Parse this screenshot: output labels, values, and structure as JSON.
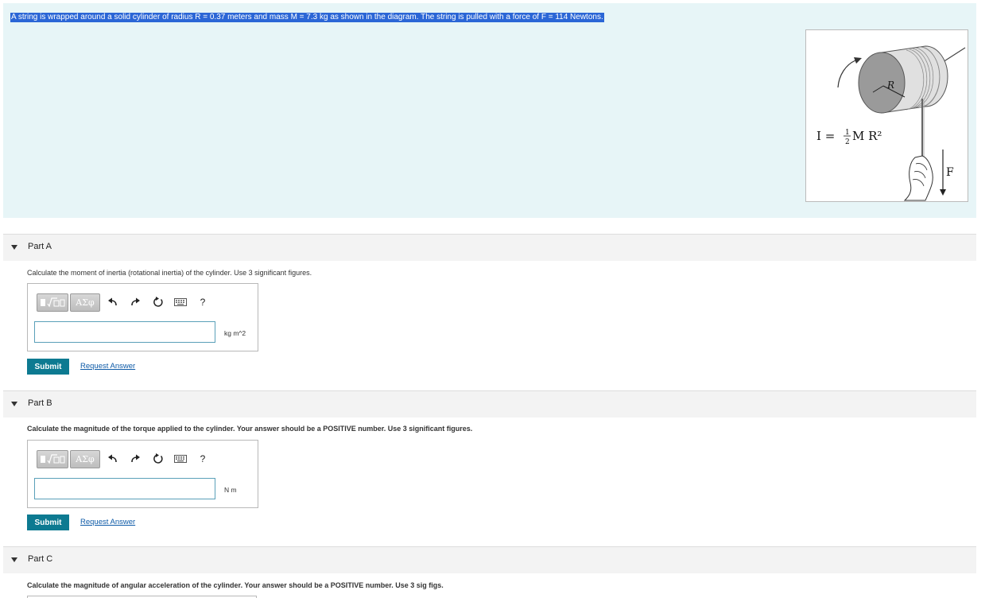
{
  "problem": {
    "statement": "A string is wrapped around a solid cylinder of radius R = 0.37 meters and mass M = 7.3 kg as shown in the diagram.  The string is pulled with a force of F = 114 Newtons.",
    "figure": {
      "radius_label": "R",
      "inertia_prefix": "I = ",
      "fraction_num": "1",
      "fraction_den": "2",
      "inertia_suffix": "M R²",
      "force_label": "F"
    }
  },
  "toolbar": {
    "symbols_label": "ΑΣφ",
    "help_label": "?"
  },
  "parts": [
    {
      "title": "Part A",
      "instruction": "Calculate the moment of inertia (rotational inertia) of the cylinder.  Use 3 significant figures.",
      "answer_value": "",
      "unit": "kg m^2",
      "submit_label": "Submit",
      "request_label": "Request Answer"
    },
    {
      "title": "Part B",
      "instruction": "Calculate the magnitude of the torque applied to the cylinder.  Your answer should be a POSITIVE number.  Use 3 significant figures.",
      "answer_value": "",
      "unit": "N m",
      "submit_label": "Submit",
      "request_label": "Request Answer"
    },
    {
      "title": "Part C",
      "instruction": "Calculate the magnitude of angular acceleration of the cylinder.  Your answer should be a POSITIVE number.  Use 3 sig figs."
    }
  ],
  "colors": {
    "problem_bg": "#e7f5f7",
    "highlight": "#2b66d6",
    "submit_bg": "#0d7a91",
    "link": "#0d5aa7"
  }
}
